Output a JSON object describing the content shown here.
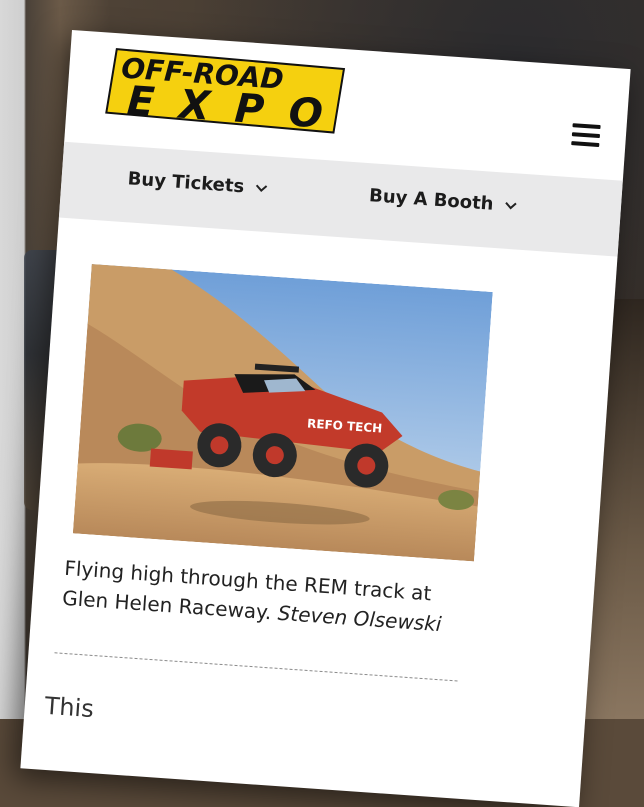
{
  "site": {
    "logo_text_top": "OFF-ROAD",
    "logo_text_bottom": "EXPO"
  },
  "nav": {
    "items": [
      {
        "label": "Buy Tickets"
      },
      {
        "label": "Buy A Booth"
      }
    ]
  },
  "article": {
    "caption_text": "Flying high through the REM track at Glen Helen Raceway.",
    "caption_credit": "Steven Olsewski",
    "truck_decal": "REFO TECH",
    "body_start": "This"
  },
  "colors": {
    "logo_yellow": "#f5d00f",
    "logo_black": "#111111",
    "nav_bg": "#e9e9ea",
    "text": "#222222"
  },
  "icons": {
    "menu": "hamburger-icon",
    "dropdown": "chevron-down-icon"
  }
}
